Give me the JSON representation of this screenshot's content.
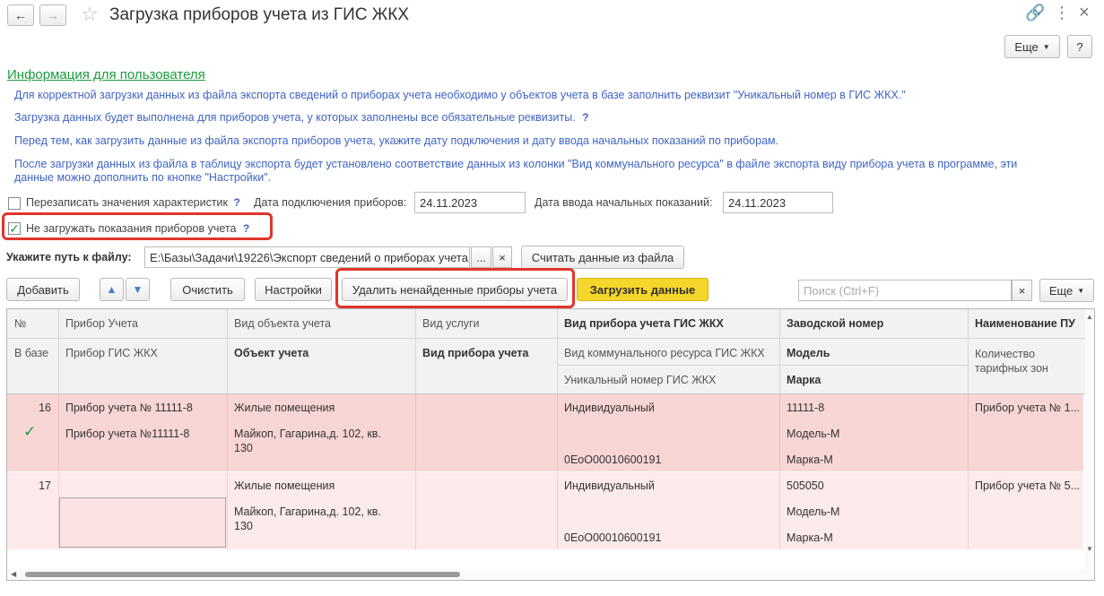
{
  "window": {
    "title": "Загрузка приборов учета из ГИС ЖКХ",
    "more_label": "Еще",
    "help_label": "?"
  },
  "info": {
    "heading": "Информация для пользователя",
    "line1": "Для корректной загрузки данных из файла экспорта сведений о приборах учета необходимо у объектов учета в базе заполнить реквизит \"Уникальный номер в ГИС ЖКХ.\"",
    "line2": "Загрузка данных будет выполнена для приборов учета, у которых заполнены все обязательные реквизиты.",
    "line3": "Перед тем, как загрузить данные из файла экспорта приборов учета, укажите дату подключения и дату ввода начальных показаний по приборам.",
    "line4a": "После загрузки данных из файла в таблицу экспорта будет установлено соответствие данных из колонки \"Вид коммунального ресурса\" в файле экспорта виду прибора учета в программе, эти",
    "line4b": "данные можно дополнить по кнопке \"Настройки\".",
    "q": "?"
  },
  "options": {
    "overwrite_label": "Перезаписать значения характеристик",
    "connect_date_label": "Дата подключения приборов:",
    "connect_date_value": "24.11.2023",
    "initial_date_label": "Дата ввода начальных показаний:",
    "initial_date_value": "24.11.2023",
    "no_readings_label": "Не загружать показания приборов учета",
    "q": "?"
  },
  "file": {
    "label": "Укажите путь к файлу:",
    "path": "E:\\Базы\\Задачи\\19226\\Экспорт сведений о приборах учета",
    "browse": "...",
    "clear": "×",
    "read_button": "Считать данные из файла"
  },
  "toolbar": {
    "add": "Добавить",
    "up": "▲",
    "down": "▼",
    "clear": "Очистить",
    "settings": "Настройки",
    "delete_not_found": "Удалить ненайденные приборы учета",
    "load": "Загрузить данные",
    "search_placeholder": "Поиск (Ctrl+F)",
    "search_clear": "×",
    "more": "Еще"
  },
  "table": {
    "headers": {
      "num": "№",
      "in_base": "В базе",
      "device": "Прибор Учета",
      "device_gis": "Прибор ГИС ЖКХ",
      "object_type": "Вид объекта учета",
      "object": "Объект учета",
      "service": "Вид услуги",
      "device_type": "Вид прибора учета",
      "device_type_gis": "Вид прибора учета ГИС ЖКХ",
      "resource_type": "Вид коммунального ресурса ГИС ЖКХ",
      "unique_num": "Уникальный номер ГИС ЖКХ",
      "serial": "Заводской номер",
      "model": "Модель",
      "brand": "Марка",
      "name": "Наименование ПУ",
      "zones": "Количество тарифных зон"
    },
    "rows": [
      {
        "num": "16",
        "check": "✓",
        "device": "Прибор учета № 11111-8",
        "device_gis": "Прибор учета №11111-8",
        "object_type": "Жилые помещения",
        "object": "Майкоп, Гагарина,д. 102, кв. 130",
        "device_type_gis": "Индивидуальный",
        "unique_num": "0EoO00010600191",
        "serial": "11111-8",
        "model": "Модель-М",
        "brand": "Марка-М",
        "name": "Прибор учета № 1..."
      },
      {
        "num": "17",
        "device": "",
        "device_gis": "",
        "object_type": "Жилые помещения",
        "object": "Майкоп, Гагарина,д. 102, кв. 130",
        "device_type_gis": "Индивидуальный",
        "unique_num": "0EoO00010600191",
        "serial": "505050",
        "model": "Модель-М",
        "brand": "Марка-М",
        "name": "Прибор учета № 5..."
      }
    ]
  },
  "colors": {
    "accent_yellow": "#f5d62a",
    "highlight_red": "#e0352b",
    "row_pink": "#f9d6d6",
    "row_pink_light": "#fdeaea",
    "link_green": "#1a9c3a",
    "info_blue": "#3e64c4"
  }
}
